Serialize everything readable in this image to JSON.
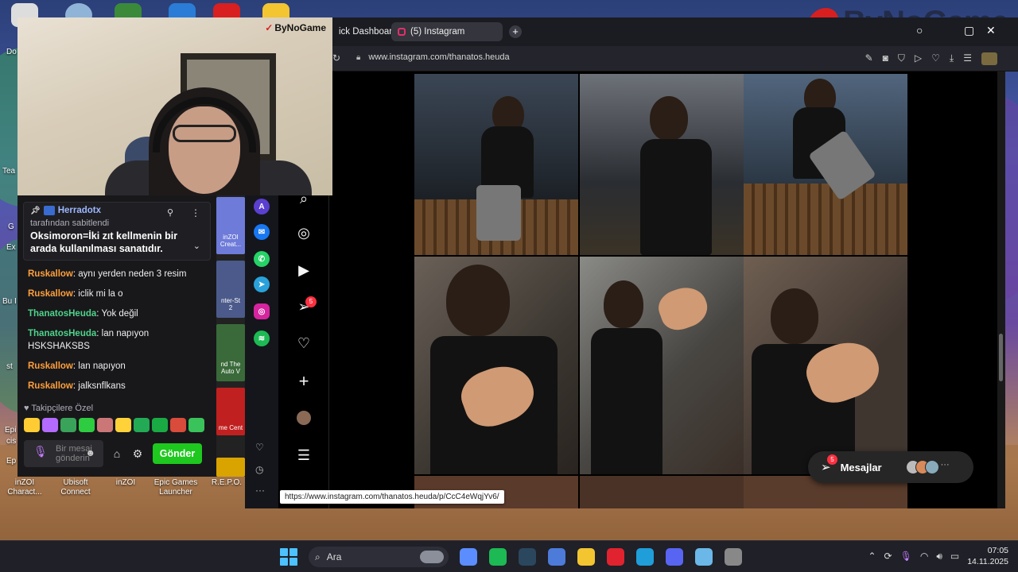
{
  "desktop": {
    "icons": [
      {
        "label": "inZOI\nCharact...",
        "color": "#2a7cd6"
      },
      {
        "label": "Ubisoft\nConnect",
        "color": "#1b4fbf"
      },
      {
        "label": "inZOI",
        "color": "#3a8be0"
      },
      {
        "label": "Epic Games\nLauncher",
        "color": "#222"
      },
      {
        "label": "R.E.P.O.",
        "color": "#d9a300"
      }
    ],
    "left_edge_labels": [
      "Do",
      "Tea",
      "G",
      "Ex",
      "Bu I",
      "st",
      "Epi",
      "cis",
      "Ep"
    ]
  },
  "watermark": {
    "text": "ByNoGame"
  },
  "webcam": {
    "brand": "ByNoGame"
  },
  "chat": {
    "pinned": {
      "user": "Herradotx",
      "subtitle": "tarafından sabitlendi",
      "message": "Oksimoron=İki zıt kellmenin bir arada kullanılması sanatıdır."
    },
    "messages": [
      {
        "user": "Ruskallow",
        "color": "orange",
        "text": "aynı yerden neden 3 resim"
      },
      {
        "user": "Ruskallow",
        "color": "orange",
        "text": "iclik mi la o"
      },
      {
        "user": "ThanatosHeuda",
        "color": "green",
        "text": "Yok değil"
      },
      {
        "user": "ThanatosHeuda",
        "color": "green",
        "text": "lan napıyon HSKSHAKSBS"
      },
      {
        "user": "Ruskallow",
        "color": "orange",
        "text": "lan napıyon"
      },
      {
        "user": "Ruskallow",
        "color": "orange",
        "text": "jalksnflkans"
      }
    ],
    "follower_label": "Takipçilere Özel",
    "emote_colors": [
      "#ffcc33",
      "#b36bff",
      "#3aa35a",
      "#2ecc40",
      "#c77",
      "#ffd23a",
      "#22aa55",
      "#1aaa44",
      "#d94b3a",
      "#3ac35a"
    ],
    "input_placeholder": "Bir mesaj gönderin",
    "send_label": "Gönder"
  },
  "thumbs": [
    {
      "label": "inZOI\nCreat...",
      "color": "#6e7bd9"
    },
    {
      "label": "nter-St\n2",
      "color": "#4b5a8a"
    },
    {
      "label": "nd The\nAuto V",
      "color": "#3a6a3a"
    },
    {
      "label": "me Cent",
      "color": "#c02020"
    }
  ],
  "browser": {
    "tab_partial": "ick Dashboard",
    "tab_active": "(5) Instagram",
    "new_tab": "+",
    "url": "www.instagram.com/thanatos.heuda",
    "hover_url": "https://www.instagram.com/thanatos.heuda/p/CcC4eWqjYv6/"
  },
  "instagram": {
    "notifications_badge": "5",
    "messages_label": "Mesajlar",
    "messages_badge": "5",
    "posts": [
      {
        "tone": "#2f3a46"
      },
      {
        "tone": "#3b3f47"
      },
      {
        "tone": "#3d4c5e"
      },
      {
        "tone": "#4a4440"
      },
      {
        "tone": "#3a3a3a"
      },
      {
        "tone": "#4a4038"
      }
    ]
  },
  "taskbar": {
    "search_label": "Ara",
    "time": "07:05",
    "date": "14.11.2025",
    "apps": [
      {
        "name": "copilot",
        "color": "#5b8dff"
      },
      {
        "name": "spotify",
        "color": "#1db954"
      },
      {
        "name": "steam",
        "color": "#2a475e"
      },
      {
        "name": "chrome-like",
        "color": "#4c7bd9"
      },
      {
        "name": "file-explorer",
        "color": "#f2c531"
      },
      {
        "name": "opera-gx",
        "color": "#e0232e"
      },
      {
        "name": "edge",
        "color": "#1f9ed9"
      },
      {
        "name": "discord",
        "color": "#5865f2"
      },
      {
        "name": "app-gear",
        "color": "#6bb8e8"
      },
      {
        "name": "obs",
        "color": "#888"
      }
    ]
  }
}
